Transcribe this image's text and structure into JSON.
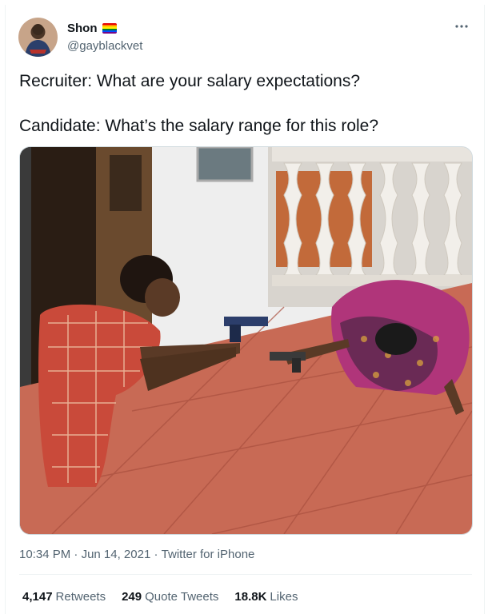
{
  "author": {
    "display_name": "Shon",
    "handle": "@gayblackvet",
    "flag_colors": [
      "#e40303",
      "#ff8c00",
      "#ffed00",
      "#008026",
      "#004dff",
      "#750787"
    ]
  },
  "tweet": {
    "lines": [
      "Recruiter: What are your salary expectations?",
      "Candidate: What’s the salary range for this role?"
    ],
    "time": "10:34 PM",
    "date": "Jun 14, 2021",
    "source": "Twitter for iPhone",
    "separator": " · "
  },
  "stats": {
    "retweets": {
      "count": "4,147",
      "label": "Retweets"
    },
    "quotes": {
      "count": "249",
      "label": "Quote Tweets"
    },
    "likes": {
      "count": "18.8K",
      "label": "Likes"
    }
  },
  "icons": {
    "more": "more-horizontal-icon"
  },
  "colors": {
    "text": "#0f1419",
    "secondary": "#536471",
    "border": "#cfd9de"
  }
}
